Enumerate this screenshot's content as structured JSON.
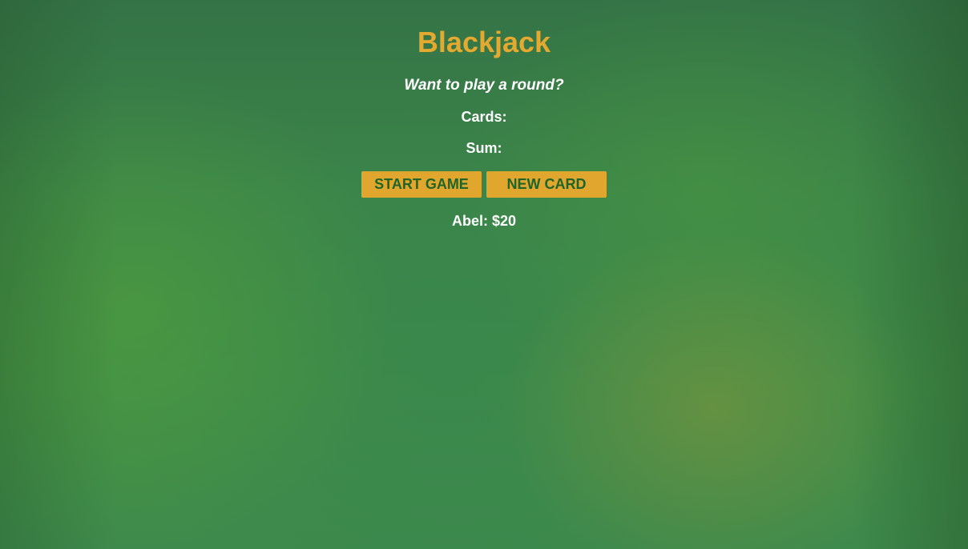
{
  "title": "Blackjack",
  "message": "Want to play a round?",
  "cards": {
    "label": "Cards:",
    "value": ""
  },
  "sum": {
    "label": "Sum:",
    "value": ""
  },
  "buttons": {
    "start": "START GAME",
    "new_card": "NEW CARD"
  },
  "player": "Abel: $20",
  "colors": {
    "title": "#e5a930",
    "button_bg": "#e0a62e",
    "button_text": "#1f6428",
    "background": "#3d8a45"
  }
}
